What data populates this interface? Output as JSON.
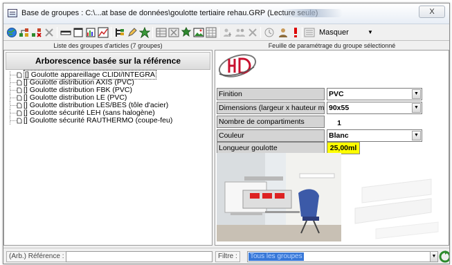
{
  "window": {
    "title": "Base de groupes : C:\\...at base de données\\goulotte tertiaire rehau.GRP (Lecture seule)",
    "close_label": "X"
  },
  "toolbar": {
    "icons": [
      "globe-icon",
      "tree-people-icon",
      "tree-remove-icon",
      "delete-icon",
      "minimize-icon",
      "window-icon",
      "chart-window-icon",
      "chart-icon",
      "hierarchy-icon",
      "edit-icon",
      "star-icon",
      "table-icon",
      "table-x-icon",
      "tree-star-icon",
      "image-icon",
      "grid-icon",
      "person-icon",
      "person-group-icon",
      "close-x-icon",
      "clock-icon",
      "users-icon",
      "exclamation-icon",
      "list-icon"
    ],
    "masquer_label": "Masquer"
  },
  "left": {
    "header": "Liste des groupes d'articles (7 groupes)",
    "tree_title": "Arborescence basée sur la référence",
    "items": [
      {
        "label": "[] Goulotte appareillage CLIDI/INTEGRA"
      },
      {
        "label": "[] Goulotte distribution AXIS (PVC)"
      },
      {
        "label": "[] Goulotte distribution FBK (PVC)"
      },
      {
        "label": "[] Goulotte distribution LE (PVC)"
      },
      {
        "label": "[] Goulotte distribution LES/BES (tôle d'acier)"
      },
      {
        "label": "[] Goulotte sécurité LEH (sans halogène)"
      },
      {
        "label": "[] Goulotte sécurité RAUTHERMO (coupe-feu)"
      }
    ]
  },
  "right": {
    "header": "Feuille de paramétrage du groupe sélectionné",
    "params": [
      {
        "label": "Finition",
        "value": "PVC",
        "kind": "combo"
      },
      {
        "label": "Dimensions (largeur x hauteur mm)",
        "value": "90x55",
        "kind": "combo"
      },
      {
        "label": "Nombre de compartiments",
        "value": "1",
        "kind": "num"
      },
      {
        "label": "Couleur",
        "value": "Blanc",
        "kind": "combo"
      },
      {
        "label": "Longueur goulotte",
        "value": "25,00ml",
        "kind": "highlight"
      }
    ],
    "highlight_color": "#ffff00"
  },
  "bottom": {
    "ref_label": "(Arb.) Référence :",
    "ref_value": "",
    "filter_label": "Filtre :",
    "filter_value": "Tous les groupes"
  }
}
